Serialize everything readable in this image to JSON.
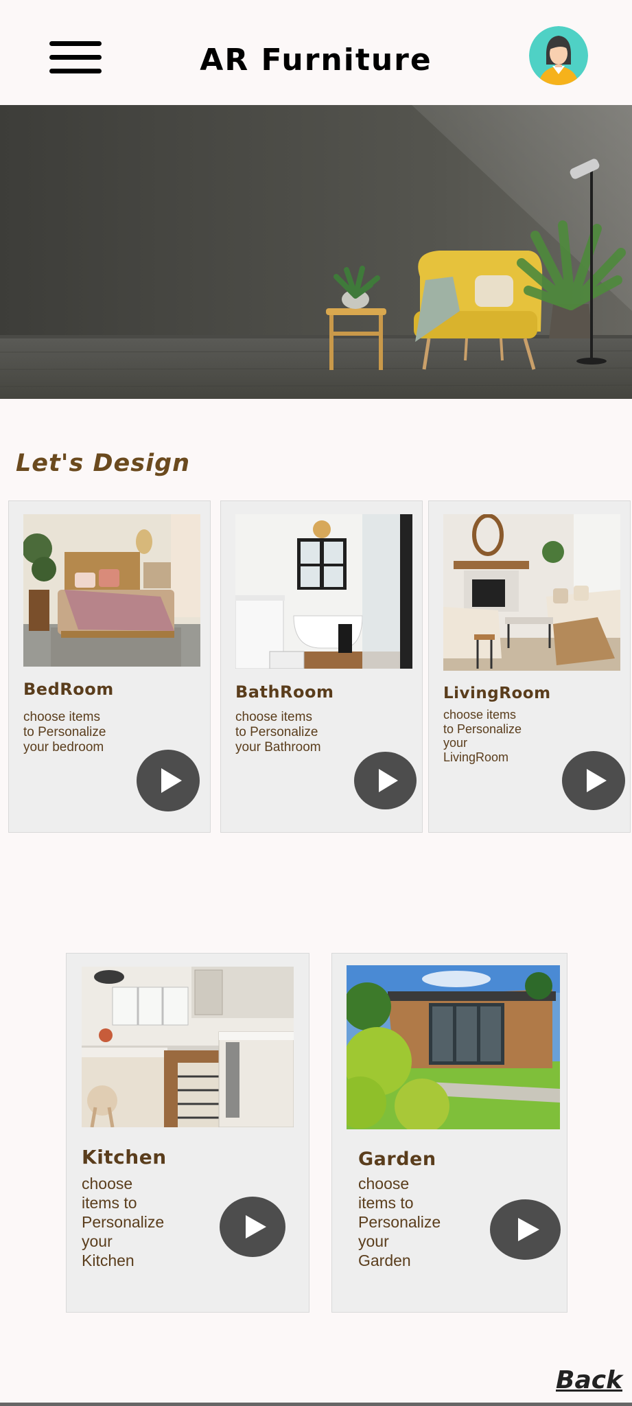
{
  "header": {
    "title": "AR Furniture",
    "menu_icon": "hamburger-menu-icon",
    "profile_icon": "user-avatar-icon"
  },
  "section": {
    "title": "Let's Design"
  },
  "rooms": [
    {
      "title": "BedRoom",
      "description": "choose items\nto Personalize\nyour bedroom",
      "image": "bedroom-photo"
    },
    {
      "title": "BathRoom",
      "description": "choose items\nto Personalize\nyour Bathroom",
      "image": "bathroom-photo"
    },
    {
      "title": "LivingRoom",
      "description": "choose items\nto Personalize\nyour\nLivingRoom",
      "image": "livingroom-photo"
    },
    {
      "title": "Kitchen",
      "description": "choose\nitems to\nPersonalize\nyour\nKitchen",
      "image": "kitchen-photo"
    },
    {
      "title": "Garden",
      "description": "choose\nitems to\nPersonalize\nyour\nGarden",
      "image": "garden-photo"
    }
  ],
  "footer": {
    "back_label": "Back"
  },
  "colors": {
    "background": "#fcf8f8",
    "card": "#eeeeee",
    "accent_text": "#5a3d1c",
    "play_button": "#4d4d4d"
  }
}
